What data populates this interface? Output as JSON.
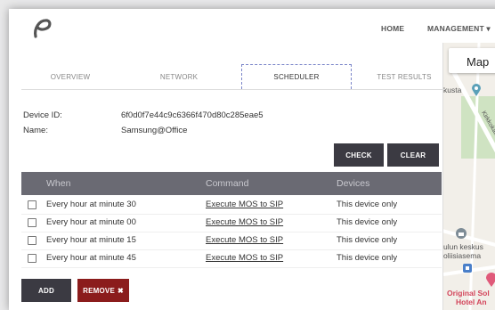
{
  "nav": {
    "home": "HOME",
    "management": "MANAGEMENT"
  },
  "tabs": [
    "OVERVIEW",
    "NETWORK",
    "SCHEDULER",
    "TEST RESULTS"
  ],
  "active_tab": "SCHEDULER",
  "device": {
    "id_label": "Device ID:",
    "id_value": "6f0d0f7e44c9c6366f470d80c285eae5",
    "name_label": "Name:",
    "name_value": "Samsung@Office"
  },
  "buttons": {
    "check": "CHECK",
    "clear": "CLEAR",
    "add": "ADD",
    "remove": "REMOVE"
  },
  "table": {
    "headers": [
      "When",
      "Command",
      "Devices"
    ],
    "rows": [
      {
        "when": "Every hour at minute 30",
        "command": "Execute MOS to SIP",
        "devices": "This device only"
      },
      {
        "when": "Every hour at minute 00",
        "command": "Execute MOS to SIP",
        "devices": "This device only"
      },
      {
        "when": "Every hour at minute 15",
        "command": "Execute MOS to SIP",
        "devices": "This device only"
      },
      {
        "when": "Every hour at minute 45",
        "command": "Execute MOS to SIP",
        "devices": "This device only"
      }
    ]
  },
  "map": {
    "title": "Map",
    "labels": [
      "kusta",
      "Kirkkokatu",
      "ulun keskus",
      "oliisiasema",
      "Original Sol",
      "Hotel An"
    ]
  },
  "colors": {
    "table_header": "#6a6a73",
    "button_dark": "#3b3a42",
    "button_red": "#8b1c1c",
    "tab_active_border": "#7b86c9"
  }
}
